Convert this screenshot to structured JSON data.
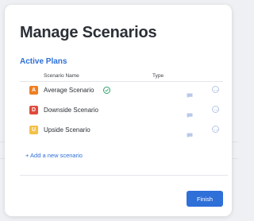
{
  "modal": {
    "title": "Manage Scenarios",
    "section_title": "Active Plans",
    "columns": {
      "name": "Scenario Name",
      "type": "Type"
    },
    "rows": [
      {
        "badge": "A",
        "badge_color": "#ef7f22",
        "name": "Average Scenario",
        "active": true
      },
      {
        "badge": "D",
        "badge_color": "#e04a3a",
        "name": "Downside Scenario",
        "active": false
      },
      {
        "badge": "U",
        "badge_color": "#f5c048",
        "name": "Upside Scenario",
        "active": false
      }
    ],
    "add_link": "+ Add a new scenario",
    "finish_label": "Finish"
  },
  "colors": {
    "accent": "#2e6fd8",
    "check": "#2ea36b"
  }
}
